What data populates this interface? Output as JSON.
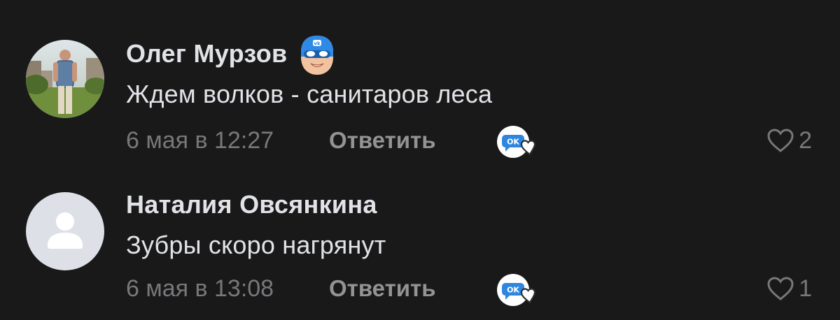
{
  "comments": [
    {
      "author": "Олег Мурзов",
      "avatar": "user-photo",
      "badge_icon": "vk-hero-mask-icon",
      "text": "Ждем волков - санитаров леса",
      "timestamp": "6 мая в 12:27",
      "reply_label": "Ответить",
      "reaction_icon": "ok-heart-icon",
      "like_icon": "heart-outline-icon",
      "likes": "2"
    },
    {
      "author": "Наталия Овсянкина",
      "avatar": "default-user-avatar",
      "text": "Зубры скоро нагрянут",
      "timestamp": "6 мая в 13:08",
      "reply_label": "Ответить",
      "reaction_icon": "ok-heart-icon",
      "like_icon": "heart-outline-icon",
      "likes": "1"
    }
  ],
  "colors": {
    "background": "#19191a",
    "primary_text": "#e1e3e6",
    "secondary_text": "#76787a",
    "reply_text": "#939393",
    "vk_blue": "#2688eb",
    "default_avatar_bg": "#dde1e7"
  }
}
